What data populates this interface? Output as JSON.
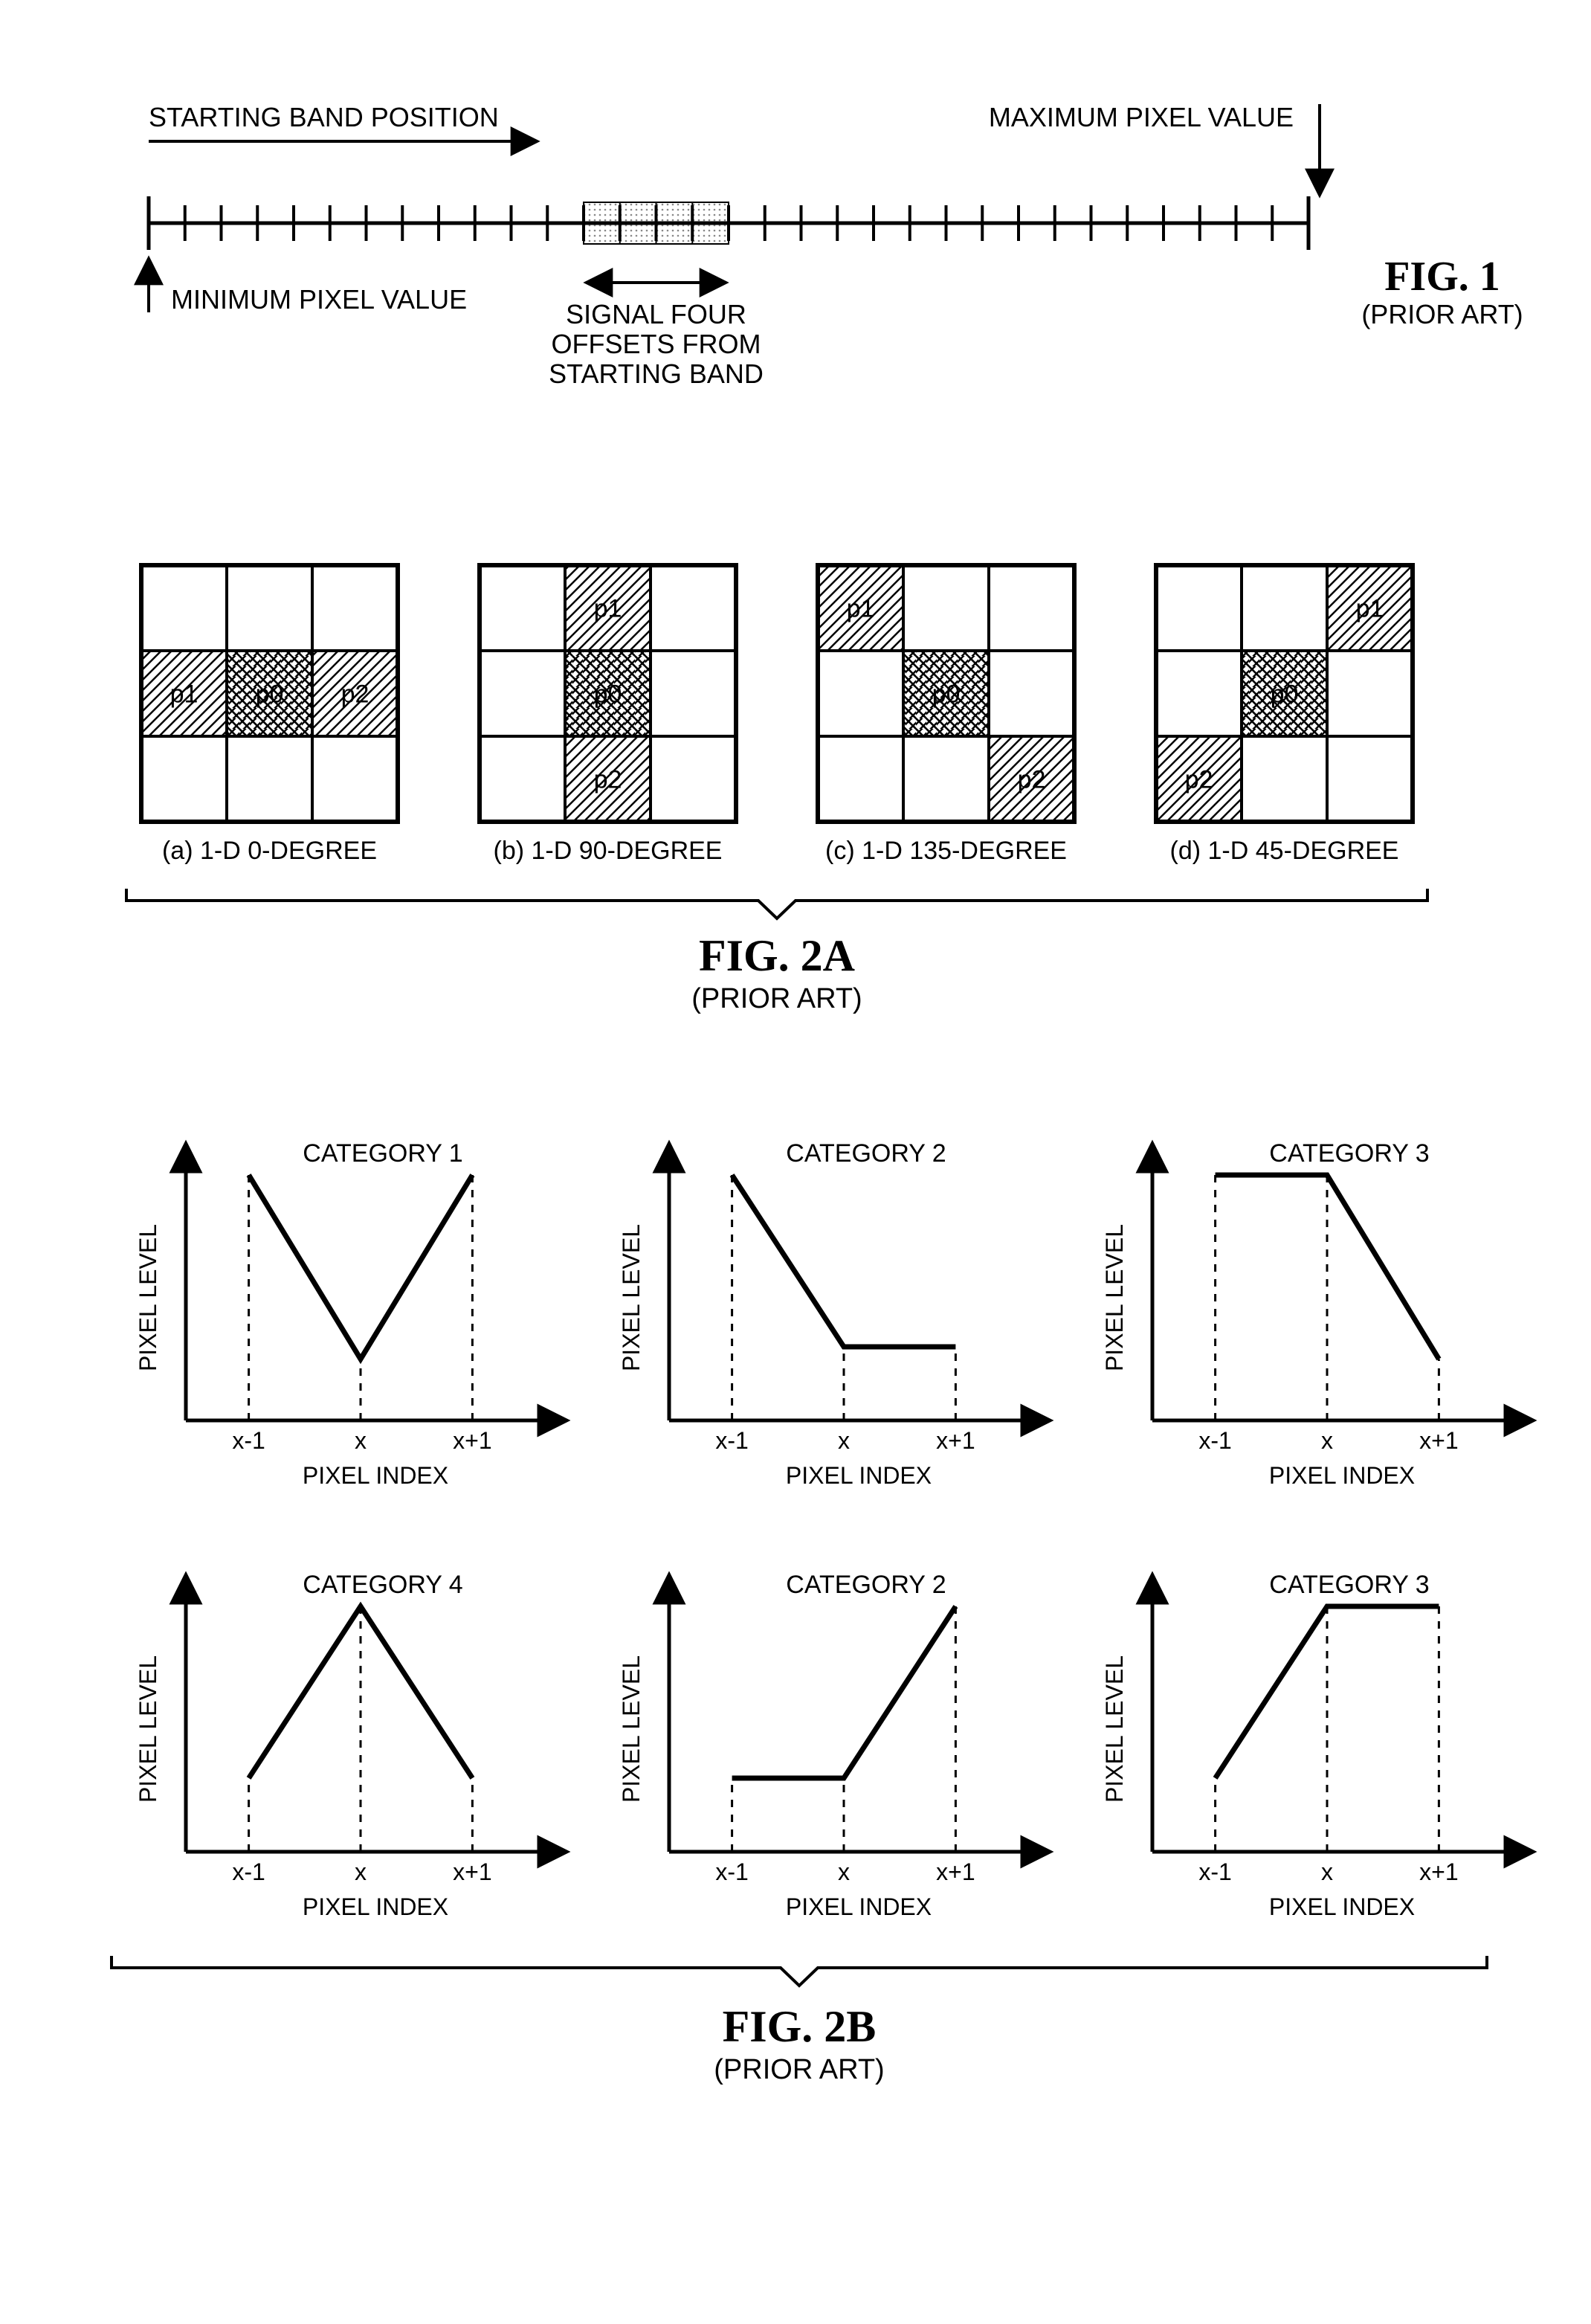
{
  "fig1": {
    "title": "FIG. 1",
    "subtitle": "(PRIOR ART)",
    "starting_band": "STARTING BAND POSITION",
    "max_pixel": "MAXIMUM PIXEL VALUE",
    "min_pixel": "MINIMUM PIXEL VALUE",
    "signal_text": "SIGNAL FOUR\nOFFSETS FROM\nSTARTING BAND",
    "ticks": 32,
    "shaded_start": 12,
    "shaded_span": 4
  },
  "fig2a": {
    "title": "FIG. 2A",
    "subtitle": "(PRIOR ART)",
    "grids": [
      {
        "label": "(a) 1-D 0-DEGREE",
        "cells": [
          {
            "r": 1,
            "c": 0,
            "t": "p1",
            "h": "diag1"
          },
          {
            "r": 1,
            "c": 1,
            "t": "p0",
            "h": "diag2"
          },
          {
            "r": 1,
            "c": 2,
            "t": "p2",
            "h": "diag1"
          }
        ]
      },
      {
        "label": "(b) 1-D 90-DEGREE",
        "cells": [
          {
            "r": 0,
            "c": 1,
            "t": "p1",
            "h": "diag1"
          },
          {
            "r": 1,
            "c": 1,
            "t": "p0",
            "h": "diag2"
          },
          {
            "r": 2,
            "c": 1,
            "t": "p2",
            "h": "diag1"
          }
        ]
      },
      {
        "label": "(c) 1-D 135-DEGREE",
        "cells": [
          {
            "r": 0,
            "c": 0,
            "t": "p1",
            "h": "diag1"
          },
          {
            "r": 1,
            "c": 1,
            "t": "p0",
            "h": "diag2"
          },
          {
            "r": 2,
            "c": 2,
            "t": "p2",
            "h": "diag1"
          }
        ]
      },
      {
        "label": "(d) 1-D 45-DEGREE",
        "cells": [
          {
            "r": 0,
            "c": 2,
            "t": "p1",
            "h": "diag1"
          },
          {
            "r": 1,
            "c": 1,
            "t": "p0",
            "h": "diag2"
          },
          {
            "r": 2,
            "c": 0,
            "t": "p2",
            "h": "diag1"
          }
        ]
      }
    ]
  },
  "fig2b": {
    "title": "FIG. 2B",
    "subtitle": "(PRIOR ART)",
    "ylabel": "PIXEL LEVEL",
    "xlabel": "PIXEL INDEX",
    "xticks": [
      "x-1",
      "x",
      "x+1"
    ],
    "plots": [
      {
        "title": "CATEGORY 1",
        "y": [
          1.0,
          0.25,
          1.0
        ]
      },
      {
        "title": "CATEGORY 2",
        "y": [
          1.0,
          0.3,
          0.3
        ]
      },
      {
        "title": "CATEGORY 3",
        "y": [
          1.0,
          1.0,
          0.25
        ]
      },
      {
        "title": "CATEGORY 4",
        "y": [
          0.3,
          1.0,
          0.3
        ]
      },
      {
        "title": "CATEGORY 2",
        "y": [
          0.3,
          0.3,
          1.0
        ]
      },
      {
        "title": "CATEGORY 3",
        "y": [
          0.3,
          1.0,
          1.0
        ]
      }
    ]
  },
  "chart_data": {
    "type": "line",
    "categories": [
      "x-1",
      "x",
      "x+1"
    ],
    "series": [
      {
        "name": "CATEGORY 1",
        "values": [
          1.0,
          0.25,
          1.0
        ]
      },
      {
        "name": "CATEGORY 2",
        "values": [
          1.0,
          0.3,
          0.3
        ]
      },
      {
        "name": "CATEGORY 3",
        "values": [
          1.0,
          1.0,
          0.25
        ]
      },
      {
        "name": "CATEGORY 4",
        "values": [
          0.3,
          1.0,
          0.3
        ]
      },
      {
        "name": "CATEGORY 2",
        "values": [
          0.3,
          0.3,
          1.0
        ]
      },
      {
        "name": "CATEGORY 3",
        "values": [
          0.3,
          1.0,
          1.0
        ]
      }
    ],
    "xlabel": "PIXEL INDEX",
    "ylabel": "PIXEL LEVEL",
    "ylim": [
      0,
      1.1
    ]
  }
}
